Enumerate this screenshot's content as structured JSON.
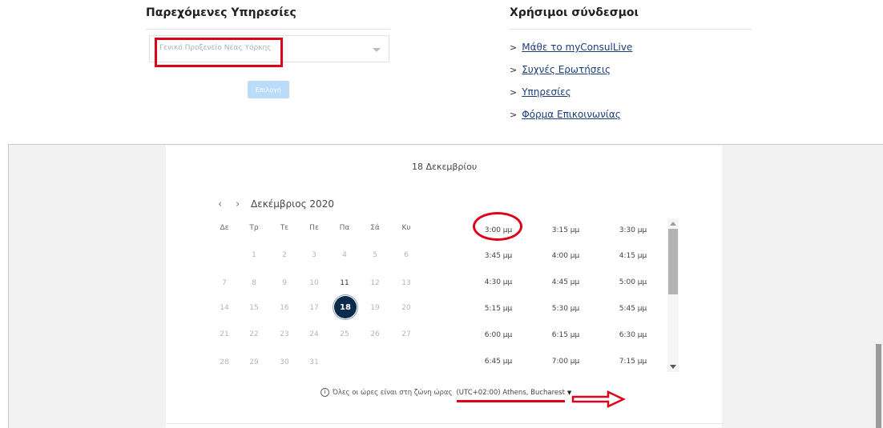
{
  "services": {
    "title": "Παρεχόμενες Υπηρεσίες",
    "selected_value": "Γενικό Προξενείο Νέας Υόρκης",
    "choose_label": "Επιλογή"
  },
  "links": {
    "title": "Χρήσιμοι σύνδεσμοι",
    "chevron": ">",
    "items": [
      {
        "label": "Μάθε το myConsulLive"
      },
      {
        "label": "Συχνές Ερωτήσεις"
      },
      {
        "label": "Υπηρεσίες"
      },
      {
        "label": "Φόρμα Επικοινωνίας"
      }
    ]
  },
  "booking": {
    "date_heading": "18 Δεκεμβρίου",
    "calendar": {
      "prev": "‹",
      "next": "›",
      "month_label": "Δεκέμβριος 2020",
      "weekdays": [
        "Δε",
        "Τρ",
        "Τε",
        "Πε",
        "Πα",
        "Σά",
        "Κυ"
      ],
      "selected_day": "18",
      "weeks": [
        [
          "",
          "1",
          "2",
          "3",
          "4",
          "5",
          "6"
        ],
        [
          "7",
          "8",
          "9",
          "10",
          "11",
          "12",
          "13"
        ],
        [
          "14",
          "15",
          "16",
          "17",
          "18",
          "19",
          "20"
        ],
        [
          "21",
          "22",
          "23",
          "24",
          "25",
          "26",
          "27"
        ],
        [
          "28",
          "29",
          "30",
          "31",
          "",
          "",
          ""
        ]
      ],
      "available_days": [
        "11",
        "18"
      ]
    },
    "time_slots": [
      [
        "3:00 μμ",
        "3:15 μμ",
        "3:30 μμ"
      ],
      [
        "3:45 μμ",
        "4:00 μμ",
        "4:15 μμ"
      ],
      [
        "4:30 μμ",
        "4:45 μμ",
        "5:00 μμ"
      ],
      [
        "5:15 μμ",
        "5:30 μμ",
        "5:45 μμ"
      ],
      [
        "6:00 μμ",
        "6:15 μμ",
        "6:30 μμ"
      ],
      [
        "6:45 μμ",
        "7:00 μμ",
        "7:15 μμ"
      ]
    ],
    "timezone_note": "Όλες οι ώρες είναι στη ζώνη ώρας",
    "timezone_value": "(UTC+02:00) Athens, Bucharest",
    "info_glyph": "i"
  },
  "colors": {
    "annotation": "#e0001a",
    "selected_day_bg": "#0b2a4c",
    "link": "#1c3f7a",
    "button_disabled": "#b9dcfb"
  }
}
